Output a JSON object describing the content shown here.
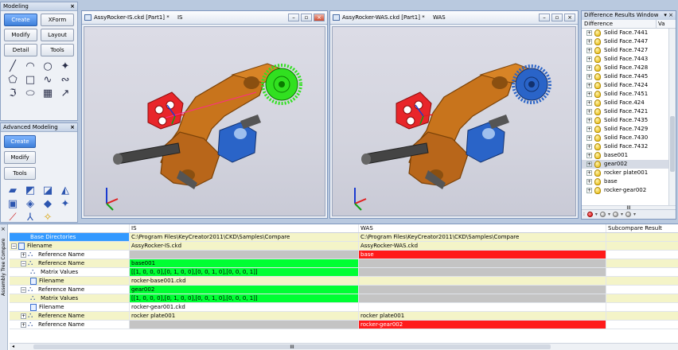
{
  "modeling": {
    "title": "Modeling",
    "rows": [
      [
        "Create",
        "XForm"
      ],
      [
        "Modify",
        "Layout"
      ],
      [
        "Detail",
        "Tools"
      ]
    ],
    "active": "Create",
    "tool_icons": [
      "line-icon",
      "arc-icon",
      "circle-icon",
      "point-icon",
      "polygon-icon",
      "rect-icon",
      "spline-icon",
      "wave-icon",
      "curve-icon",
      "ellipse-icon",
      "hatch-icon",
      "leader-icon"
    ]
  },
  "advanced": {
    "title": "Advanced Modeling",
    "buttons": [
      "Create",
      "Modify",
      "Tools"
    ],
    "active": "Create"
  },
  "viewports": [
    {
      "title": "AssyRocker-IS.ckd [Part1] *",
      "tag": "IS"
    },
    {
      "title": "AssyRocker-WAS.ckd [Part1] *",
      "tag": "WAS"
    }
  ],
  "diff": {
    "title": "Difference Results Window",
    "col_difference": "Difference",
    "col_value": "Va",
    "items": [
      "Solid Face.7441",
      "Solid Face.7447",
      "Solid Face.7427",
      "Solid Face.7443",
      "Solid Face.7428",
      "Solid Face.7445",
      "Solid Face.7424",
      "Solid Face.7451",
      "Solid Face.424",
      "Solid Face.7421",
      "Solid Face.7435",
      "Solid Face.7429",
      "Solid Face.7430",
      "Solid Face.7432",
      "base001",
      "gear002",
      "rocker plate001",
      "base",
      "rocker-gear002"
    ],
    "selected": "gear002",
    "scroll_label": "III"
  },
  "compare": {
    "side_label": "Assembly Tree Compare",
    "headers": {
      "name": "",
      "is": "IS",
      "was": "WAS",
      "sub": "Subcompare Result"
    },
    "rows": [
      {
        "name": "Base Directories",
        "is": "C:\\Program Files\\KeyCreator2011\\CKD\\Samples\\Compare",
        "was": "C:\\Program Files\\KeyCreator2011\\CKD\\Samples\\Compare",
        "sub": "",
        "indent": 2,
        "icon": "none",
        "toggle": "",
        "style": "y",
        "name_style": "sel-blue",
        "is_style": "",
        "was_style": ""
      },
      {
        "name": "Filename",
        "is": "AssyRocker-IS.ckd",
        "was": "AssyRocker-WAS.ckd",
        "sub": "",
        "indent": 0,
        "icon": "file",
        "toggle": "−",
        "style": "y",
        "name_style": "",
        "is_style": "",
        "was_style": ""
      },
      {
        "name": "Reference Name",
        "is": "",
        "was": "base",
        "sub": "",
        "indent": 1,
        "icon": "ref",
        "toggle": "+",
        "style": "",
        "name_style": "",
        "is_style": "gray",
        "was_style": "red"
      },
      {
        "name": "Reference Name",
        "is": "base001",
        "was": "",
        "sub": "",
        "indent": 1,
        "icon": "ref",
        "toggle": "−",
        "style": "y",
        "name_style": "",
        "is_style": "green",
        "was_style": "gray"
      },
      {
        "name": "Matrix Values",
        "is": "[[1, 0, 0, 0],[0, 1, 0, 0],[0, 0, 1, 0],[0, 0, 0, 1]]",
        "was": "",
        "sub": "",
        "indent": 2,
        "icon": "ref",
        "toggle": "",
        "style": "",
        "name_style": "",
        "is_style": "green",
        "was_style": "gray"
      },
      {
        "name": "Filename",
        "is": "rocker-base001.ckd",
        "was": "",
        "sub": "",
        "indent": 2,
        "icon": "file",
        "toggle": "",
        "style": "y",
        "name_style": "",
        "is_style": "",
        "was_style": ""
      },
      {
        "name": "Reference Name",
        "is": "gear002",
        "was": "",
        "sub": "",
        "indent": 1,
        "icon": "ref",
        "toggle": "−",
        "style": "",
        "name_style": "",
        "is_style": "green",
        "was_style": "gray"
      },
      {
        "name": "Matrix Values",
        "is": "[[1, 0, 0, 0],[0, 1, 0, 0],[0, 0, 1, 0],[0, 0, 0, 1]]",
        "was": "",
        "sub": "",
        "indent": 2,
        "icon": "ref",
        "toggle": "",
        "style": "y",
        "name_style": "",
        "is_style": "green",
        "was_style": "gray"
      },
      {
        "name": "Filename",
        "is": "rocker-gear001.ckd",
        "was": "",
        "sub": "",
        "indent": 2,
        "icon": "file",
        "toggle": "",
        "style": "",
        "name_style": "",
        "is_style": "",
        "was_style": ""
      },
      {
        "name": "Reference Name",
        "is": "rocker plate001",
        "was": "rocker plate001",
        "sub": "",
        "indent": 1,
        "icon": "ref",
        "toggle": "+",
        "style": "y",
        "name_style": "",
        "is_style": "",
        "was_style": ""
      },
      {
        "name": "Reference Name",
        "is": "",
        "was": "rocker-gear002",
        "sub": "",
        "indent": 1,
        "icon": "ref",
        "toggle": "+",
        "style": "",
        "name_style": "",
        "is_style": "gray",
        "was_style": "red"
      }
    ],
    "scroll_label": "III"
  },
  "colors": {
    "body_orange": "#c8741c",
    "red_part": "#e8262a",
    "blue_part": "#2a64c8",
    "gear_green": "#31e020",
    "gear_blue": "#2a64c8",
    "diff_green": "#00ff33",
    "diff_red": "#ff1a1a"
  }
}
